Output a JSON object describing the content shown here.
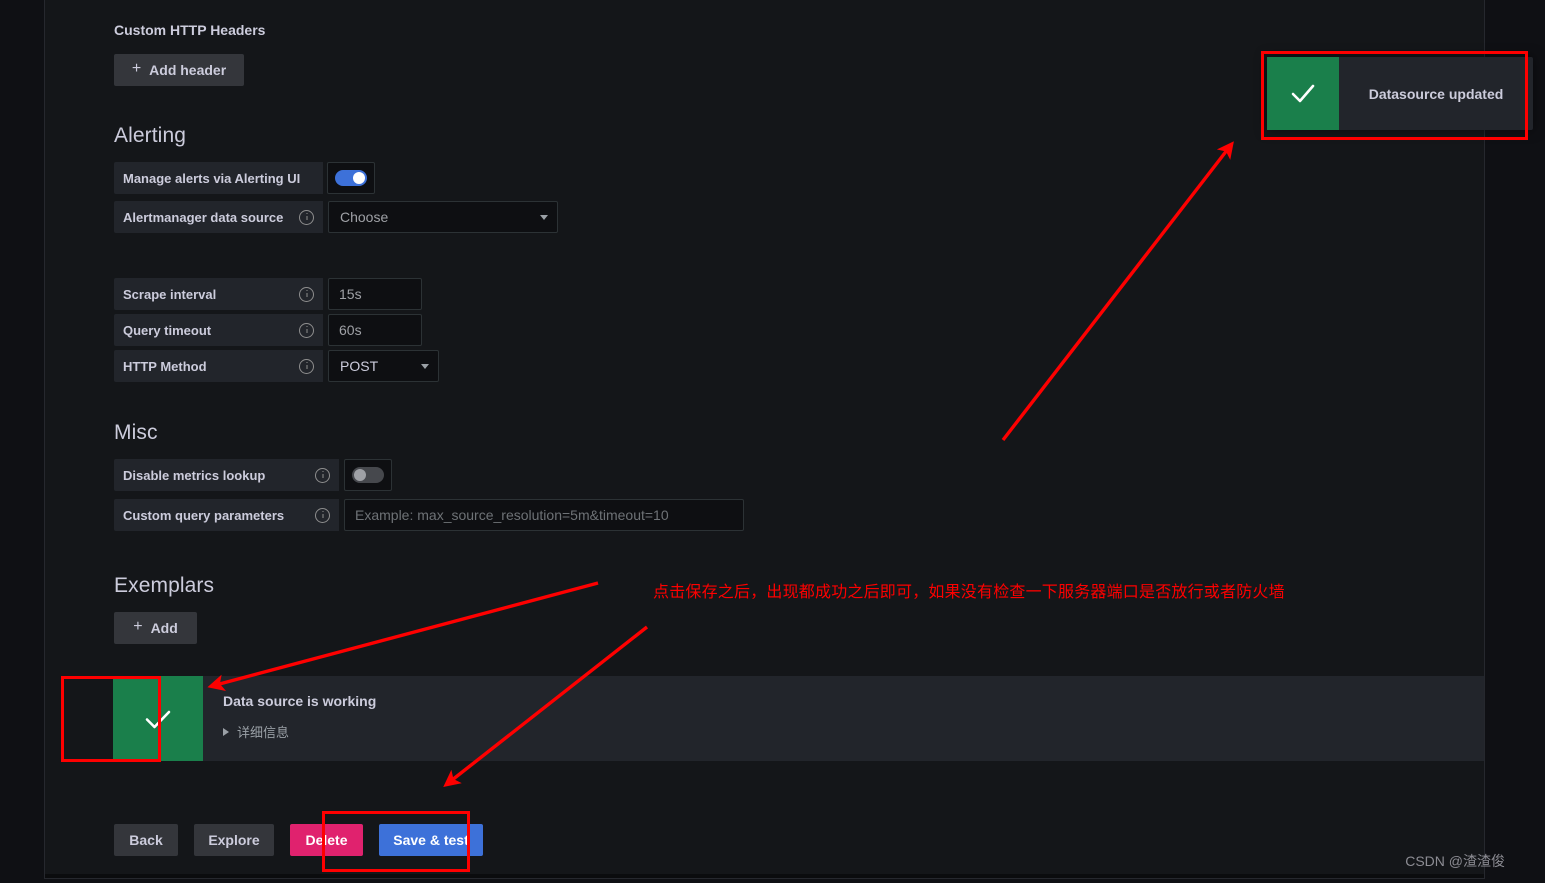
{
  "sections": {
    "custom_http_headers": {
      "title": "Custom HTTP Headers",
      "add_header_label": "Add header",
      "plus": "+"
    },
    "alerting": {
      "title": "Alerting",
      "manage_alerts_label": "Manage alerts via Alerting UI",
      "manage_alerts_state": "on",
      "alertmanager_label": "Alertmanager data source",
      "alertmanager_value": "Choose"
    },
    "connection": {
      "scrape_interval_label": "Scrape interval",
      "scrape_interval_value": "15s",
      "query_timeout_label": "Query timeout",
      "query_timeout_value": "60s",
      "http_method_label": "HTTP Method",
      "http_method_value": "POST"
    },
    "misc": {
      "title": "Misc",
      "disable_metrics_lookup_label": "Disable metrics lookup",
      "disable_metrics_lookup_state": "off",
      "custom_query_params_label": "Custom query parameters",
      "custom_query_params_placeholder": "Example: max_source_resolution=5m&timeout=10"
    },
    "exemplars": {
      "title": "Exemplars",
      "add_label": "Add",
      "plus": "+"
    }
  },
  "alert_banner": {
    "icon": "check-icon",
    "title": "Data source is working",
    "detail_label": "详细信息"
  },
  "toast": {
    "icon": "check-icon",
    "message": "Datasource updated"
  },
  "footer_buttons": {
    "back": "Back",
    "explore": "Explore",
    "delete": "Delete",
    "save_and_test": "Save & test"
  },
  "annotations": {
    "note_text": "点击保存之后，出现都成功之后即可，如果没有检查一下服务器端口是否放行或者防火墙",
    "note_color": "#fe0000",
    "rect_color": "#fe0000",
    "arrow_color": "#fe0000"
  },
  "watermark": "CSDN @渣渣俊",
  "colors": {
    "page_background": "#141619",
    "outer_background": "#0f1014",
    "label_background": "#22252b",
    "input_background": "#0e0f12",
    "primary_button": "#3d71d9",
    "danger_button": "#e0226e",
    "secondary_button": "#34363b",
    "success_green": "#1a7f4b",
    "toggle_on": "#3d71d9",
    "text_primary": "#ccccdc",
    "text_secondary": "#9aa0a6"
  }
}
